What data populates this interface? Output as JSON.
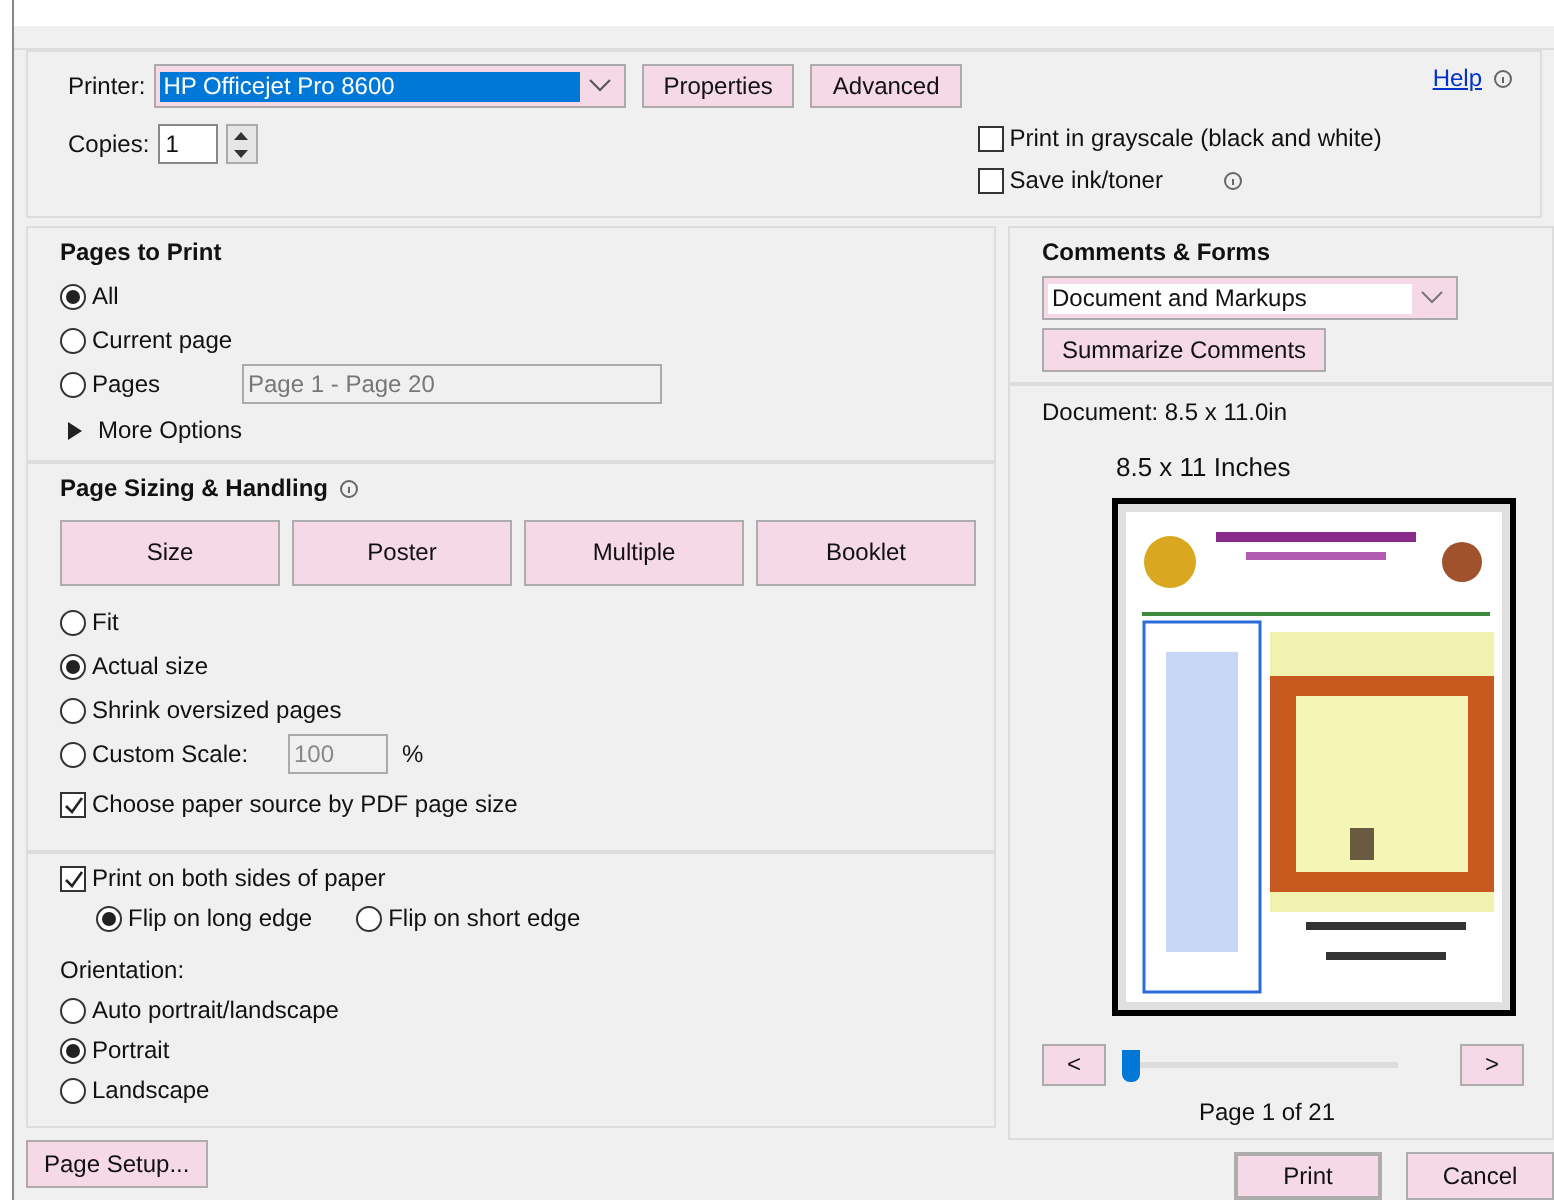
{
  "printer": {
    "label": "Printer:",
    "value": "HP Officejet Pro 8600"
  },
  "printer_buttons": [
    "Properties",
    "Advanced"
  ],
  "help": {
    "label": "Help"
  },
  "copies": {
    "label": "Copies:",
    "value": "1"
  },
  "print_options": [
    {
      "label": "Print in grayscale (black and white)",
      "checked": false,
      "info": false
    },
    {
      "label": "Save ink/toner",
      "checked": false,
      "info": true
    }
  ],
  "pages_to_print": {
    "title": "Pages to Print",
    "options": [
      {
        "label": "All",
        "selected": true
      },
      {
        "label": "Current page",
        "selected": false
      },
      {
        "label": "Pages",
        "selected": false
      }
    ],
    "pages_field": "Page 1 - Page 20",
    "more_options": {
      "label": "More Options",
      "expanded": false
    }
  },
  "page_sizing": {
    "title": "Page Sizing & Handling",
    "tabs": [
      "Size",
      "Poster",
      "Multiple",
      "Booklet"
    ],
    "options": [
      {
        "label": "Fit",
        "selected": false
      },
      {
        "label": "Actual size",
        "selected": true
      },
      {
        "label": "Shrink oversized pages",
        "selected": false
      },
      {
        "label": "Custom Scale:",
        "selected": false
      }
    ],
    "scale_value": "100",
    "scale_unit": "%",
    "paper_source": {
      "label": "Choose paper source by PDF page size",
      "checked": true
    }
  },
  "duplex": {
    "label": "Print on both sides of paper",
    "checked": true,
    "options": [
      {
        "label": "Flip on long edge",
        "selected": true
      },
      {
        "label": "Flip on short edge",
        "selected": false
      }
    ]
  },
  "orientation": {
    "label": "Orientation:",
    "options": [
      {
        "label": "Auto portrait/landscape",
        "selected": false
      },
      {
        "label": "Portrait",
        "selected": true
      },
      {
        "label": "Landscape",
        "selected": false
      }
    ]
  },
  "page_setup_button": "Page Setup...",
  "comments_forms": {
    "title": "Comments & Forms",
    "value": "Document and Markups",
    "button": "Summarize Comments"
  },
  "preview": {
    "document_size": "Document: 8.5 x 11.0in",
    "paper_size": "8.5 x 11 Inches",
    "prev": "<",
    "next": ">",
    "level": 0,
    "page": "Page 1 of 21"
  },
  "footer_buttons": [
    "Print",
    "Cancel"
  ]
}
